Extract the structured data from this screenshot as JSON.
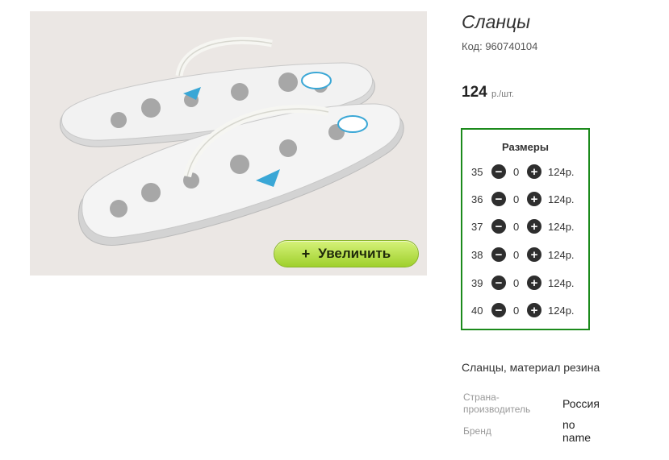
{
  "product": {
    "title": "Сланцы",
    "code": "Код: 960740104",
    "price": "124",
    "price_unit": "р./шт.",
    "zoom_label": "Увеличить",
    "zoom_plus": "+",
    "description": "Сланцы, материал резина"
  },
  "sizes": {
    "title": "Размеры",
    "rows": [
      {
        "size": "35",
        "qty": "0",
        "price": "124р."
      },
      {
        "size": "36",
        "qty": "0",
        "price": "124р."
      },
      {
        "size": "37",
        "qty": "0",
        "price": "124р."
      },
      {
        "size": "38",
        "qty": "0",
        "price": "124р."
      },
      {
        "size": "39",
        "qty": "0",
        "price": "124р."
      },
      {
        "size": "40",
        "qty": "0",
        "price": "124р."
      }
    ]
  },
  "specs": {
    "country_label_1": "Страна-",
    "country_label_2": "производитель",
    "country_value": "Россия",
    "brand_label": "Бренд",
    "brand_value_1": "no",
    "brand_value_2": "name"
  },
  "icons": {
    "minus": "minus-circle-icon",
    "plus": "plus-circle-icon"
  },
  "colors": {
    "sizes_border": "#1c8a1c",
    "zoom_button": "#b6e042"
  }
}
